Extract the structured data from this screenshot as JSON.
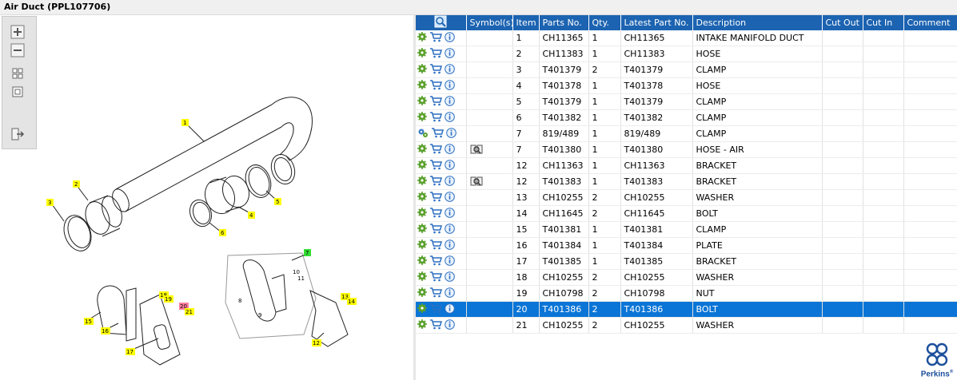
{
  "window": {
    "title": "Air Duct (PPL107706)"
  },
  "colors": {
    "header_bg": "#1c63b1",
    "selected_row": "#0a75d6",
    "label_yellow": "#ffff00",
    "label_green": "#33dd33",
    "label_pink": "#ff7f9f"
  },
  "toolbar": {
    "buttons": [
      {
        "name": "zoom-in-icon"
      },
      {
        "name": "zoom-out-icon"
      },
      {
        "name": "fit-all-icon"
      },
      {
        "name": "actual-size-icon"
      },
      {
        "name": "export-icon"
      }
    ]
  },
  "diagram": {
    "labels": [
      "1",
      "2",
      "3",
      "4",
      "5",
      "6",
      "7",
      "8",
      "9",
      "10",
      "11",
      "12",
      "13",
      "14",
      "15",
      "16",
      "17",
      "18",
      "19",
      "20",
      "21"
    ]
  },
  "table": {
    "columns": [
      "Symbol(s)",
      "Item",
      "Parts No.",
      "Qty.",
      "Latest Part No.",
      "Description",
      "Cut Out",
      "Cut In",
      "Comment"
    ],
    "rows": [
      {
        "symbol": "",
        "item": "1",
        "part": "CH11365",
        "qty": "1",
        "latest": "CH11365",
        "desc": "INTAKE MANIFOLD DUCT"
      },
      {
        "symbol": "",
        "item": "2",
        "part": "CH11383",
        "qty": "1",
        "latest": "CH11383",
        "desc": "HOSE"
      },
      {
        "symbol": "",
        "item": "3",
        "part": "T401379",
        "qty": "2",
        "latest": "T401379",
        "desc": "CLAMP"
      },
      {
        "symbol": "",
        "item": "4",
        "part": "T401378",
        "qty": "1",
        "latest": "T401378",
        "desc": "HOSE"
      },
      {
        "symbol": "",
        "item": "5",
        "part": "T401379",
        "qty": "1",
        "latest": "T401379",
        "desc": "CLAMP"
      },
      {
        "symbol": "",
        "item": "6",
        "part": "T401382",
        "qty": "1",
        "latest": "T401382",
        "desc": "CLAMP"
      },
      {
        "symbol": "",
        "item": "7",
        "part": "819/489",
        "qty": "1",
        "latest": "819/489",
        "desc": "CLAMP"
      },
      {
        "symbol": "book-icon",
        "item": "7",
        "part": "T401380",
        "qty": "1",
        "latest": "T401380",
        "desc": "HOSE - AIR"
      },
      {
        "symbol": "",
        "item": "12",
        "part": "CH11363",
        "qty": "1",
        "latest": "CH11363",
        "desc": "BRACKET"
      },
      {
        "symbol": "book-icon",
        "item": "12",
        "part": "T401383",
        "qty": "1",
        "latest": "T401383",
        "desc": "BRACKET"
      },
      {
        "symbol": "",
        "item": "13",
        "part": "CH10255",
        "qty": "2",
        "latest": "CH10255",
        "desc": "WASHER"
      },
      {
        "symbol": "",
        "item": "14",
        "part": "CH11645",
        "qty": "2",
        "latest": "CH11645",
        "desc": "BOLT"
      },
      {
        "symbol": "",
        "item": "15",
        "part": "T401381",
        "qty": "1",
        "latest": "T401381",
        "desc": "CLAMP"
      },
      {
        "symbol": "",
        "item": "16",
        "part": "T401384",
        "qty": "1",
        "latest": "T401384",
        "desc": "PLATE"
      },
      {
        "symbol": "",
        "item": "17",
        "part": "T401385",
        "qty": "1",
        "latest": "T401385",
        "desc": "BRACKET"
      },
      {
        "symbol": "",
        "item": "18",
        "part": "CH10255",
        "qty": "2",
        "latest": "CH10255",
        "desc": "WASHER"
      },
      {
        "symbol": "",
        "item": "19",
        "part": "CH10798",
        "qty": "2",
        "latest": "CH10798",
        "desc": "NUT"
      },
      {
        "symbol": "",
        "item": "20",
        "part": "T401386",
        "qty": "2",
        "latest": "T401386",
        "desc": "BOLT",
        "selected": true
      },
      {
        "symbol": "",
        "item": "21",
        "part": "CH10255",
        "qty": "2",
        "latest": "CH10255",
        "desc": "WASHER"
      }
    ]
  },
  "logo": {
    "text": "Perkins",
    "mark": "®"
  }
}
